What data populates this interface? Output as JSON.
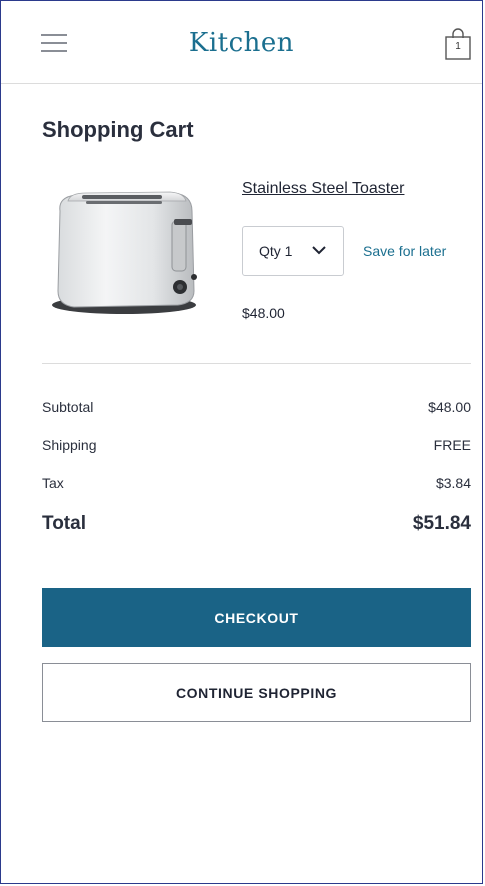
{
  "header": {
    "brand": "Kitchen",
    "menu_icon": "hamburger-menu-icon",
    "bag_icon": "shopping-bag-icon",
    "bag_count": "1",
    "brand_color": "#1b6f8f"
  },
  "cart": {
    "title": "Shopping Cart",
    "items": [
      {
        "name": "Stainless Steel Toaster",
        "quantity_label": "Qty 1",
        "save_for_later": "Save for later",
        "price": "$48.00"
      }
    ]
  },
  "summary": {
    "subtotal_label": "Subtotal",
    "subtotal_value": "$48.00",
    "shipping_label": "Shipping",
    "shipping_value": "FREE",
    "tax_label": "Tax",
    "tax_value": "$3.84",
    "total_label": "Total",
    "total_value": "$51.84"
  },
  "actions": {
    "checkout_label": "CHECKOUT",
    "continue_label": "CONTINUE SHOPPING",
    "checkout_color": "#1a6386"
  }
}
